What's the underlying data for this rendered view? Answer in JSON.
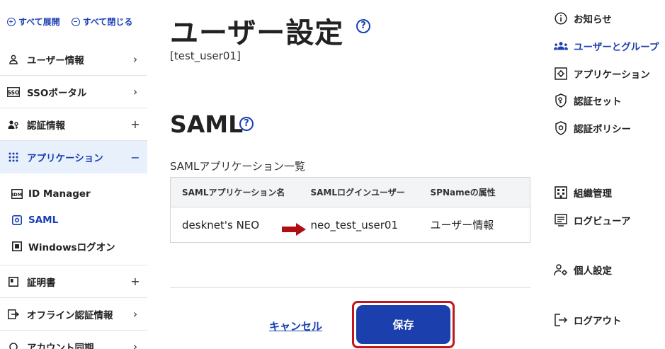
{
  "sidebar": {
    "expand_all": "すべて展開",
    "collapse_all": "すべて閉じる",
    "items": [
      {
        "label": "ユーザー情報",
        "tail": "›"
      },
      {
        "label": "SSOポータル",
        "tail": "›"
      },
      {
        "label": "認証情報",
        "tail": "+"
      },
      {
        "label": "アプリケーション",
        "tail": "−"
      }
    ],
    "sub_items": [
      {
        "label": "ID Manager"
      },
      {
        "label": "SAML"
      },
      {
        "label": "Windowsログオン"
      }
    ],
    "items_after": [
      {
        "label": "証明書",
        "tail": "+"
      },
      {
        "label": "オフライン認証情報",
        "tail": "›"
      },
      {
        "label": "アカウント同期",
        "tail": "›"
      }
    ],
    "sso_icon_text": "SSO",
    "idm_icon_text": "IDM"
  },
  "main": {
    "title": "ユーザー設定",
    "help_glyph": "?",
    "subtitle": "[test_user01]",
    "section_title": "SAML",
    "list_label": "SAMLアプリケーション一覧",
    "table": {
      "headers": [
        "SAMLアプリケーション名",
        "SAMLログインユーザー",
        "SPNameの属性"
      ],
      "rows": [
        [
          "desknet's NEO",
          "neo_test_user01",
          "ユーザー情報"
        ]
      ]
    },
    "cancel_label": "キャンセル",
    "save_label": "保存",
    "colors": {
      "accent": "#1a3fb4",
      "highlight": "#c0161e",
      "arrow": "#b00d14"
    }
  },
  "right_menu": {
    "items": [
      {
        "label": "お知らせ",
        "icon": "info-icon"
      },
      {
        "label": "ユーザーとグループ",
        "icon": "users-icon"
      },
      {
        "label": "アプリケーション",
        "icon": "app-icon"
      },
      {
        "label": "認証セット",
        "icon": "shield-key-icon"
      },
      {
        "label": "認証ポリシー",
        "icon": "shield-icon"
      },
      {
        "label": "組織管理",
        "icon": "building-icon"
      },
      {
        "label": "ログビューア",
        "icon": "log-icon"
      },
      {
        "label": "個人設定",
        "icon": "person-gear-icon"
      },
      {
        "label": "ログアウト",
        "icon": "logout-icon"
      }
    ]
  }
}
